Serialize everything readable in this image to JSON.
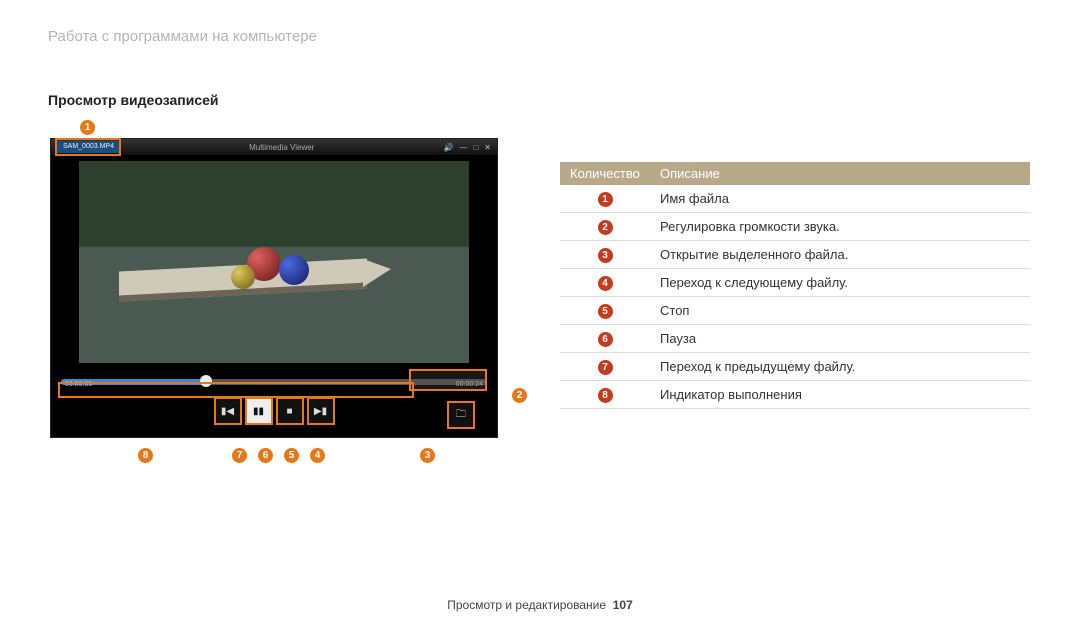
{
  "header": "Работа с программами на компьютере",
  "subheader": "Просмотр видеозаписей",
  "viewer": {
    "filename": "SAM_0003.MP4",
    "window_title": "Multimedia Viewer",
    "time_current": "00:00:09",
    "time_total": "00:00:24"
  },
  "table": {
    "col_number": "Количество",
    "col_desc": "Описание",
    "rows": [
      {
        "n": "1",
        "desc": "Имя файла"
      },
      {
        "n": "2",
        "desc": "Регулировка громкости звука."
      },
      {
        "n": "3",
        "desc": "Открытие выделенного файла."
      },
      {
        "n": "4",
        "desc": "Переход к следующему файлу."
      },
      {
        "n": "5",
        "desc": "Стоп"
      },
      {
        "n": "6",
        "desc": "Пауза"
      },
      {
        "n": "7",
        "desc": "Переход к предыдущему файлу."
      },
      {
        "n": "8",
        "desc": "Индикатор выполнения"
      }
    ]
  },
  "callouts": {
    "c1": "1",
    "c2": "2",
    "c3": "3",
    "c4": "4",
    "c5": "5",
    "c6": "6",
    "c7": "7",
    "c8": "8"
  },
  "footer": {
    "section": "Просмотр и редактирование",
    "page": "107"
  }
}
